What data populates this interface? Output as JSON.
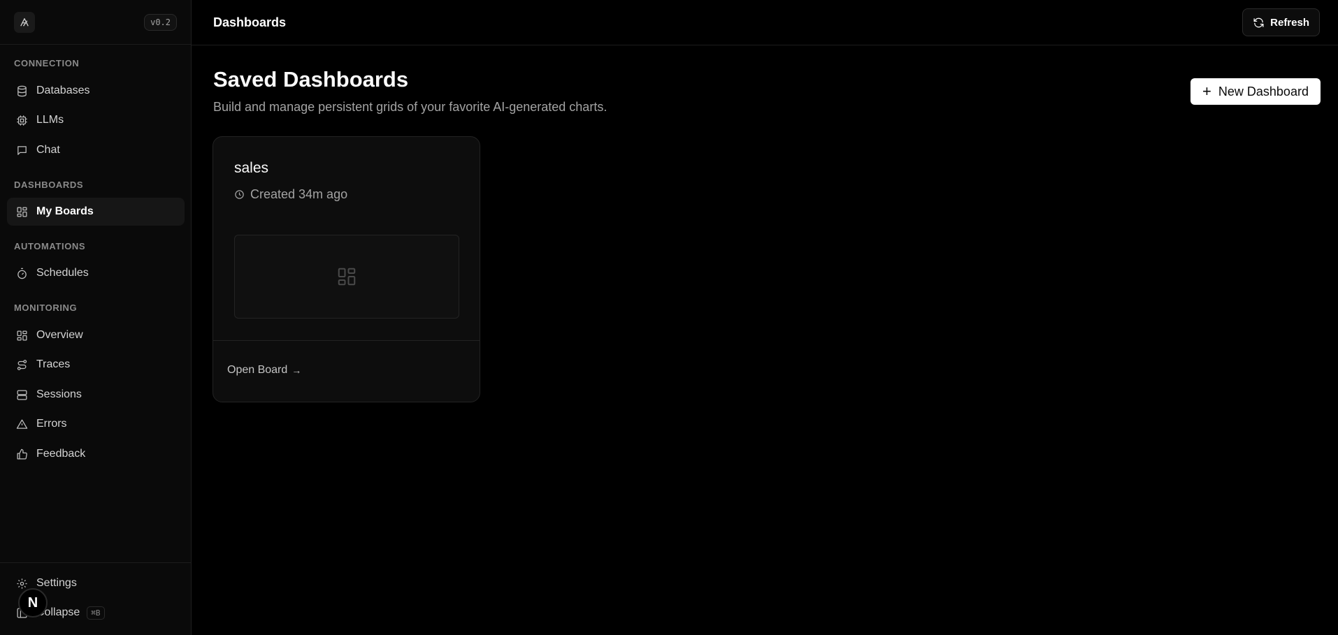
{
  "app": {
    "version": "v0.2"
  },
  "header": {
    "title": "Dashboards",
    "refresh_label": "Refresh"
  },
  "sidebar": {
    "sections": [
      {
        "label": "CONNECTION",
        "items": [
          {
            "label": "Databases",
            "icon": "database-icon"
          },
          {
            "label": "LLMs",
            "icon": "cpu-icon"
          },
          {
            "label": "Chat",
            "icon": "chat-icon"
          }
        ]
      },
      {
        "label": "DASHBOARDS",
        "items": [
          {
            "label": "My Boards",
            "icon": "layout-grid-icon",
            "active": true
          }
        ]
      },
      {
        "label": "AUTOMATIONS",
        "items": [
          {
            "label": "Schedules",
            "icon": "timer-icon"
          }
        ]
      },
      {
        "label": "MONITORING",
        "items": [
          {
            "label": "Overview",
            "icon": "layout-grid-icon"
          },
          {
            "label": "Traces",
            "icon": "route-icon"
          },
          {
            "label": "Sessions",
            "icon": "server-icon"
          },
          {
            "label": "Errors",
            "icon": "warning-icon"
          },
          {
            "label": "Feedback",
            "icon": "thumbs-up-icon"
          }
        ]
      }
    ],
    "footer": {
      "settings_label": "Settings",
      "collapse_label": "Collapse",
      "collapse_shortcut": "⌘B"
    }
  },
  "main": {
    "title": "Saved Dashboards",
    "subtitle": "Build and manage persistent grids of your favorite AI-generated charts.",
    "new_button_label": "New Dashboard",
    "cards": [
      {
        "title": "sales",
        "created": "Created 34m ago",
        "open_label": "Open Board"
      }
    ]
  },
  "badge": {
    "letter": "N"
  },
  "colors": {
    "background": "#000000",
    "sidebar": "#0a0a0a",
    "card": "#0d0d0d",
    "primary_button": "#ffffff"
  }
}
